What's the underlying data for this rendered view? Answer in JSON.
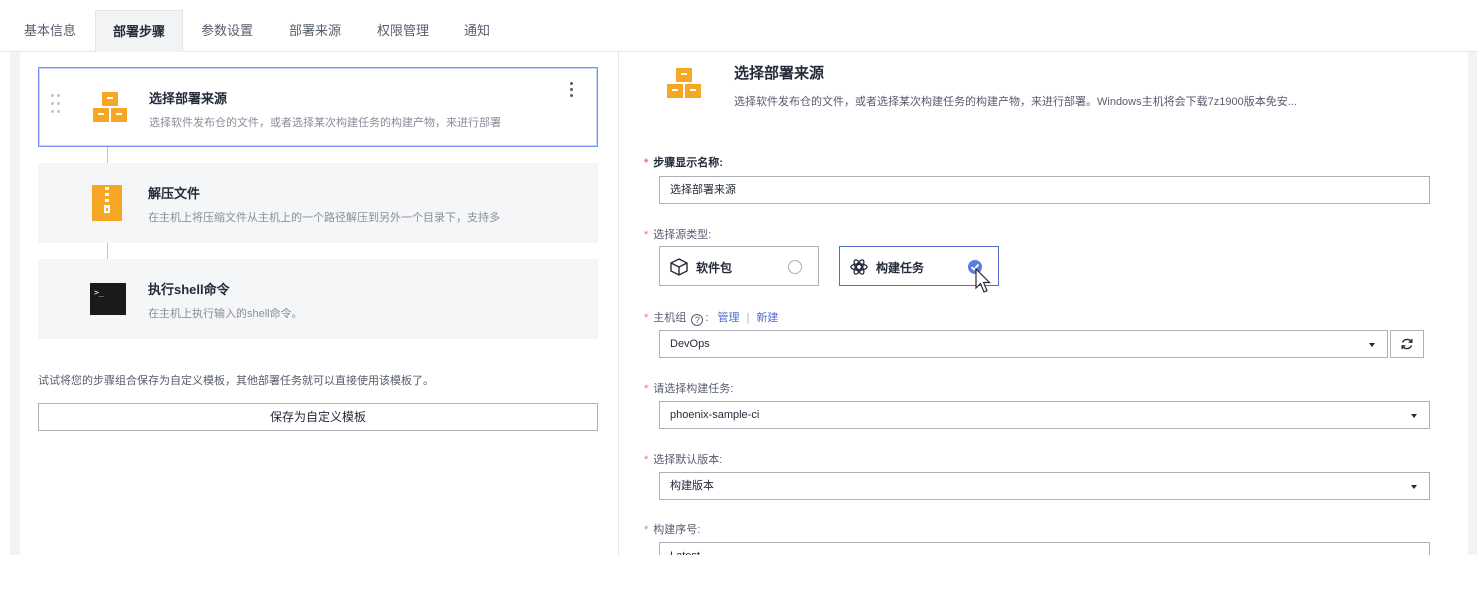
{
  "tabs": [
    {
      "label": "基本信息"
    },
    {
      "label": "部署步骤",
      "active": true
    },
    {
      "label": "参数设置"
    },
    {
      "label": "部署来源"
    },
    {
      "label": "权限管理"
    },
    {
      "label": "通知"
    }
  ],
  "steps": [
    {
      "title": "选择部署来源",
      "desc": "选择软件发布仓的文件，或者选择某次构建任务的构建产物，来进行部署",
      "icon": "boxes-icon",
      "selected": true
    },
    {
      "title": "解压文件",
      "desc": "在主机上将压缩文件从主机上的一个路径解压到另外一个目录下，支持多",
      "icon": "zip-file-icon"
    },
    {
      "title": "执行shell命令",
      "desc": "在主机上执行输入的shell命令。",
      "icon": "terminal-icon"
    }
  ],
  "template_hint": "试试将您的步骤组合保存为自定义模板，其他部署任务就可以直接使用该模板了。",
  "save_template_label": "保存为自定义模板",
  "detail": {
    "title": "选择部署来源",
    "desc": "选择软件发布仓的文件，或者选择某次构建任务的构建产物，来进行部署。Windows主机将会下载7z1900版本免安...",
    "step_name_label": "步骤显示名称:",
    "step_name_value": "选择部署来源",
    "source_type_label": "选择源类型:",
    "source_options": [
      {
        "label": "软件包",
        "icon": "package-icon",
        "selected": false
      },
      {
        "label": "构建任务",
        "icon": "build-task-icon",
        "selected": true
      }
    ],
    "host_group_label": "主机组",
    "host_group_colon": ":",
    "manage_link": "管理",
    "link_separator": "|",
    "new_link": "新建",
    "host_group_value": "DevOps",
    "build_task_label": "请选择构建任务:",
    "build_task_value": "phoenix-sample-ci",
    "default_version_label": "选择默认版本:",
    "default_version_value": "构建版本",
    "build_number_label": "构建序号:",
    "build_number_value": "Latest"
  },
  "colors": {
    "accent": "#5e7ce0",
    "link": "#526ecc",
    "required": "#f66f6a",
    "icon_orange": "#f5a623"
  }
}
